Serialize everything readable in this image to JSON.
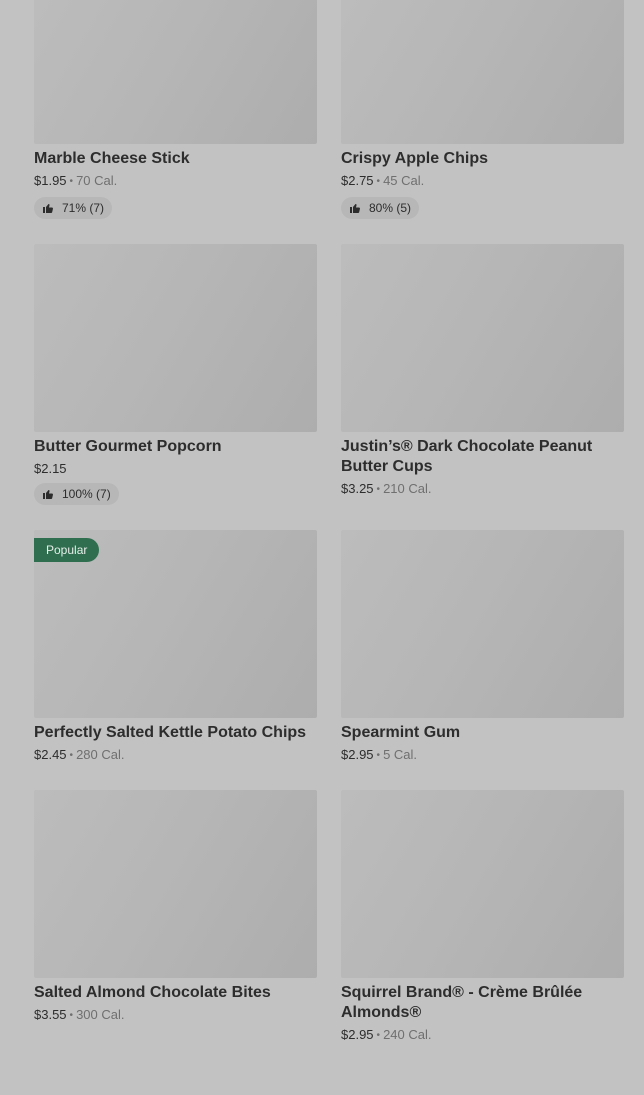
{
  "items": [
    {
      "name": "Marble Cheese Stick",
      "price": "$1.95",
      "sep": "•",
      "calories": "70 Cal.",
      "rating": "71% (7)"
    },
    {
      "name": "Crispy Apple Chips",
      "price": "$2.75",
      "sep": "•",
      "calories": "45 Cal.",
      "rating": "80% (5)"
    },
    {
      "name": "Butter Gourmet Popcorn",
      "price": "$2.15",
      "rating": "100% (7)"
    },
    {
      "name": "Justin’s® Dark Chocolate Peanut Butter Cups",
      "price": "$3.25",
      "sep": "•",
      "calories": "210 Cal."
    },
    {
      "name": "Perfectly Salted Kettle Potato Chips",
      "price": "$2.45",
      "sep": "•",
      "calories": "280 Cal.",
      "badge": "Popular"
    },
    {
      "name": "Spearmint Gum",
      "price": "$2.95",
      "sep": "•",
      "calories": "5 Cal."
    },
    {
      "name": "Salted Almond Chocolate Bites",
      "price": "$3.55",
      "sep": "•",
      "calories": "300 Cal."
    },
    {
      "name": "Squirrel Brand® - Crème Brûlée Almonds®",
      "price": "$2.95",
      "sep": "•",
      "calories": "240 Cal."
    }
  ],
  "icons": {
    "rating": "thumbs-up-icon"
  }
}
